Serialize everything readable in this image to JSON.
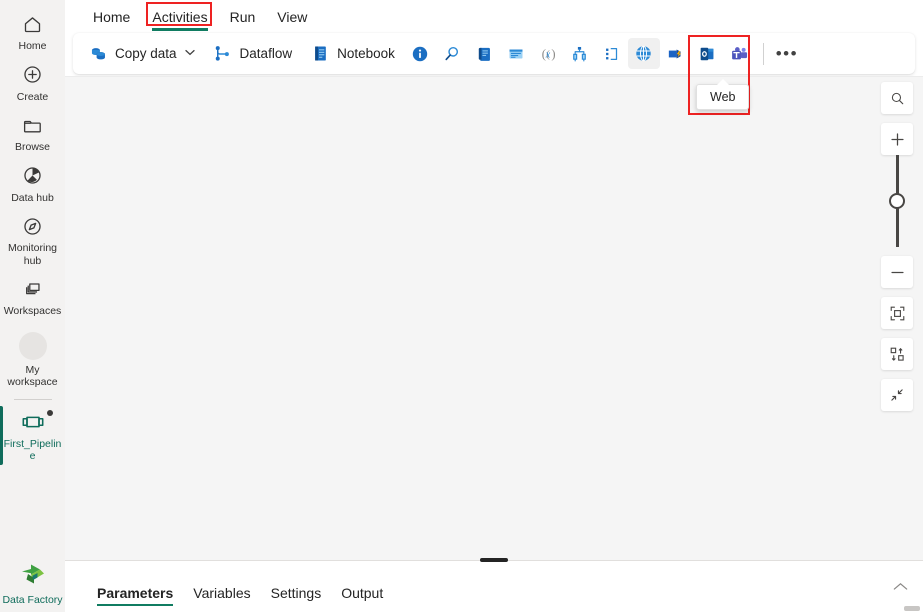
{
  "sidebar": {
    "items": [
      {
        "label": "Home",
        "icon": "home-icon"
      },
      {
        "label": "Create",
        "icon": "plus-circle-icon"
      },
      {
        "label": "Browse",
        "icon": "folder-icon"
      },
      {
        "label": "Data hub",
        "icon": "data-hub-icon"
      },
      {
        "label": "Monitoring hub",
        "icon": "monitoring-hub-icon"
      },
      {
        "label": "Workspaces",
        "icon": "workspaces-icon"
      },
      {
        "label": "My workspace",
        "icon": "workspace-avatar"
      }
    ],
    "pipeline_item": {
      "label": "First_Pipeline",
      "icon": "pipeline-icon",
      "unsaved": true
    },
    "brand": {
      "label": "Data Factory",
      "icon": "data-factory-logo"
    }
  },
  "menu": {
    "tabs": [
      {
        "label": "Home",
        "active": false
      },
      {
        "label": "Activities",
        "active": true,
        "highlighted": true
      },
      {
        "label": "Run",
        "active": false
      },
      {
        "label": "View",
        "active": false
      }
    ]
  },
  "toolbar": {
    "copy_data": {
      "label": "Copy data",
      "icon": "copy-data-icon",
      "has_dropdown": true
    },
    "dataflow": {
      "label": "Dataflow",
      "icon": "dataflow-icon"
    },
    "notebook": {
      "label": "Notebook",
      "icon": "notebook-icon"
    },
    "icon_buttons": [
      {
        "name": "get-metadata-icon",
        "title": "Get metadata"
      },
      {
        "name": "lookup-icon",
        "title": "Lookup"
      },
      {
        "name": "script-icon",
        "title": "Script"
      },
      {
        "name": "stored-procedure-icon",
        "title": "Stored procedure"
      },
      {
        "name": "set-variable-icon",
        "title": "Set variable"
      },
      {
        "name": "switch-icon",
        "title": "Switch"
      },
      {
        "name": "append-variable-icon",
        "title": "Append variable"
      }
    ],
    "web_button": {
      "name": "web-icon",
      "title": "Web",
      "highlighted": true
    },
    "trailing_icons": [
      {
        "name": "azure-function-icon",
        "title": "Azure function"
      },
      {
        "name": "outlook-icon",
        "title": "Office 365 Outlook"
      },
      {
        "name": "teams-icon",
        "title": "Teams"
      }
    ],
    "overflow": {
      "label": "•••",
      "name": "more-options"
    }
  },
  "tooltip": {
    "text": "Web"
  },
  "zoom_controls": [
    {
      "name": "zoom-search-icon",
      "title": "Search"
    },
    {
      "name": "zoom-in-icon",
      "title": "Zoom in"
    },
    {
      "name": "zoom-slider",
      "title": "Zoom level"
    },
    {
      "name": "zoom-out-icon",
      "title": "Zoom out"
    },
    {
      "name": "fit-to-screen-icon",
      "title": "Fit to screen"
    },
    {
      "name": "auto-layout-icon",
      "title": "Auto layout"
    },
    {
      "name": "collapse-canvas-icon",
      "title": "Collapse"
    }
  ],
  "bottom_panel": {
    "tabs": [
      {
        "label": "Parameters",
        "active": true
      },
      {
        "label": "Variables",
        "active": false
      },
      {
        "label": "Settings",
        "active": false
      },
      {
        "label": "Output",
        "active": false
      }
    ],
    "collapse_icon": "chevron-up-icon"
  },
  "colors": {
    "accent_teal": "#107c61",
    "highlight_red": "#ee2222",
    "canvas_bg": "#f5f5f5",
    "rail_bg": "#f3f2f1"
  }
}
